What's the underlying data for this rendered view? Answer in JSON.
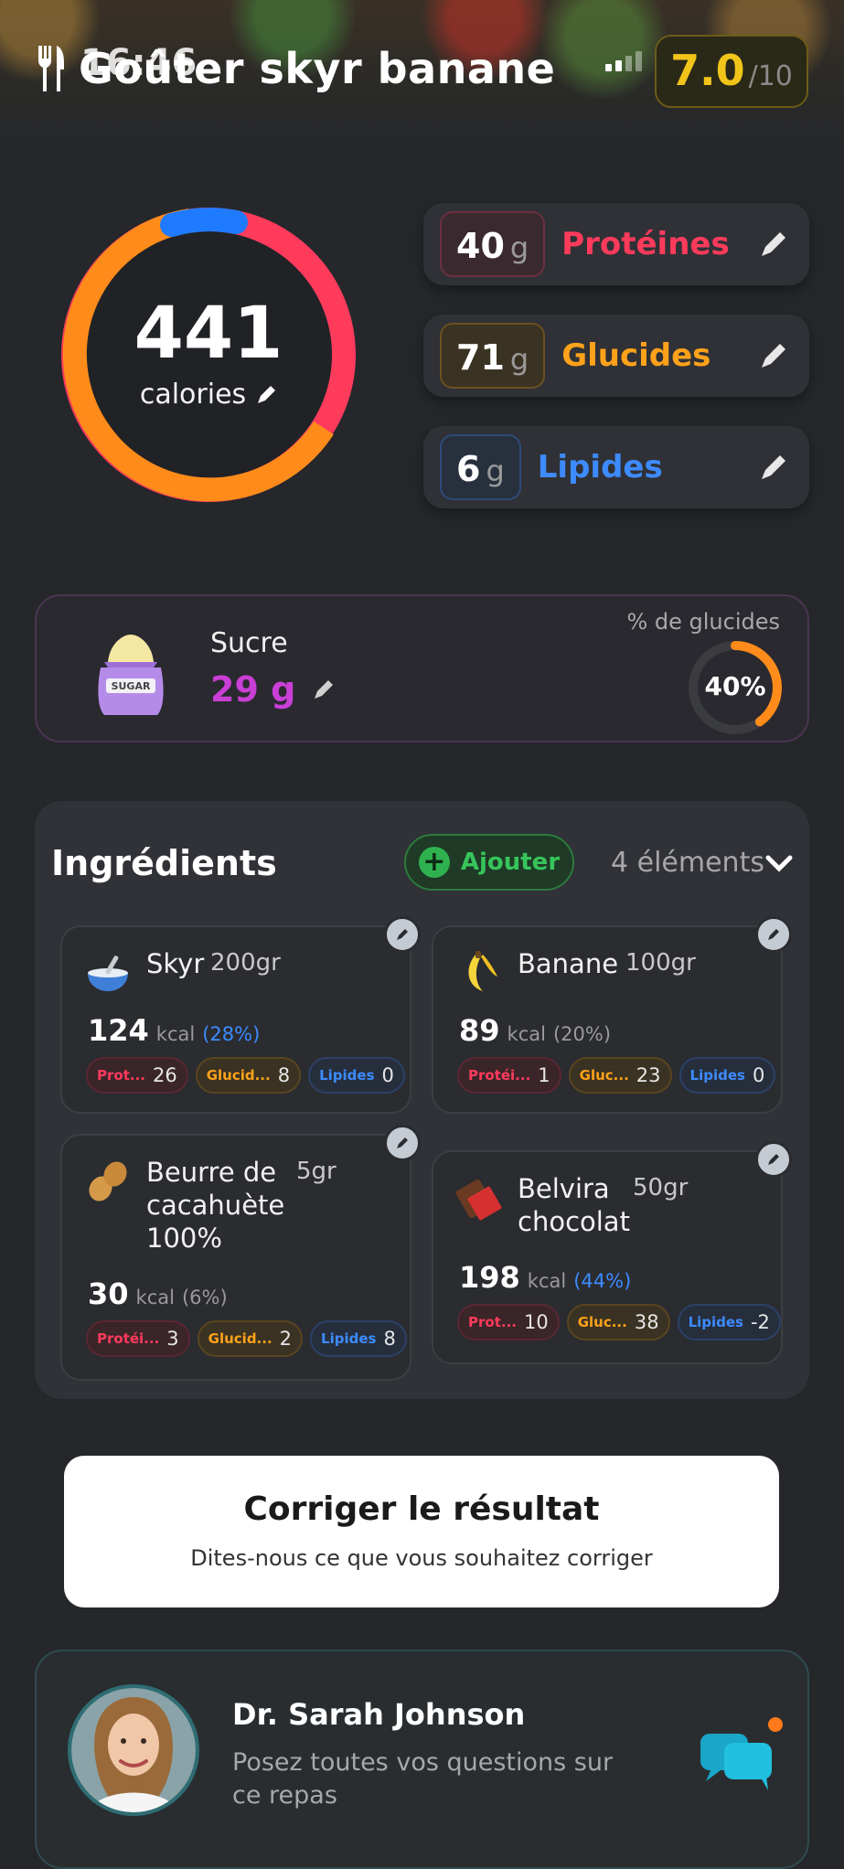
{
  "status_bar": {
    "time": "16:46",
    "network": "5G"
  },
  "header": {
    "title": "Goûter skyr banane",
    "score": "7.0",
    "score_max": "/10"
  },
  "calories": {
    "value": "441",
    "label": "calories"
  },
  "macros": [
    {
      "value": "40",
      "unit": "g",
      "name": "Protéines",
      "color": "#ff3b5c",
      "border": "#6b3040"
    },
    {
      "value": "71",
      "unit": "g",
      "name": "Glucides",
      "color": "#ffa21a",
      "border": "#6b5020"
    },
    {
      "value": "6",
      "unit": "g",
      "name": "Lipides",
      "color": "#3d8bff",
      "border": "#2f4a78"
    }
  ],
  "sugar": {
    "title": "Sucre",
    "value": "29 g",
    "pct_label": "% de glucides",
    "pct": "40%",
    "pct_fraction": 0.4,
    "icon_text": "SUGAR"
  },
  "ingredients": {
    "title": "Ingrédients",
    "add_label": "Ajouter",
    "count": "4 éléments",
    "items": [
      {
        "name": "Skyr",
        "qty": "200gr",
        "kcal": "124",
        "kcal_unit": "kcal",
        "pct": "(28%)",
        "pct_color": "#3d8bff",
        "chips": [
          {
            "name": "Prot...",
            "val": "26"
          },
          {
            "name": "Glucid...",
            "val": "8"
          },
          {
            "name": "Lipides",
            "val": "0"
          }
        ],
        "icon": "bowl-icon"
      },
      {
        "name": "Banane",
        "qty": "100gr",
        "kcal": "89",
        "kcal_unit": "kcal",
        "pct": "(20%)",
        "pct_color": "#9a9a9a",
        "chips": [
          {
            "name": "Protéi...",
            "val": "1"
          },
          {
            "name": "Gluc...",
            "val": "23"
          },
          {
            "name": "Lipides",
            "val": "0"
          }
        ],
        "icon": "banana-icon"
      },
      {
        "name": "Beurre de cacahuète 100%",
        "qty": "5gr",
        "kcal": "30",
        "kcal_unit": "kcal",
        "pct": "(6%)",
        "pct_color": "#9a9a9a",
        "chips": [
          {
            "name": "Protéi...",
            "val": "3"
          },
          {
            "name": "Glucid...",
            "val": "2"
          },
          {
            "name": "Lipides",
            "val": "8"
          }
        ],
        "icon": "peanut-icon"
      },
      {
        "name": "Belvira chocolat",
        "qty": "50gr",
        "kcal": "198",
        "kcal_unit": "kcal",
        "pct": "(44%)",
        "pct_color": "#3d8bff",
        "chips": [
          {
            "name": "Prot...",
            "val": "10"
          },
          {
            "name": "Gluc...",
            "val": "38"
          },
          {
            "name": "Lipides",
            "val": "-2"
          }
        ],
        "icon": "chocolate-icon"
      }
    ]
  },
  "correct": {
    "title": "Corriger le résultat",
    "subtitle": "Dites-nous ce que vous souhaitez corriger"
  },
  "doctor": {
    "name": "Dr. Sarah Johnson",
    "subtitle": "Posez toutes vos questions sur ce repas"
  }
}
